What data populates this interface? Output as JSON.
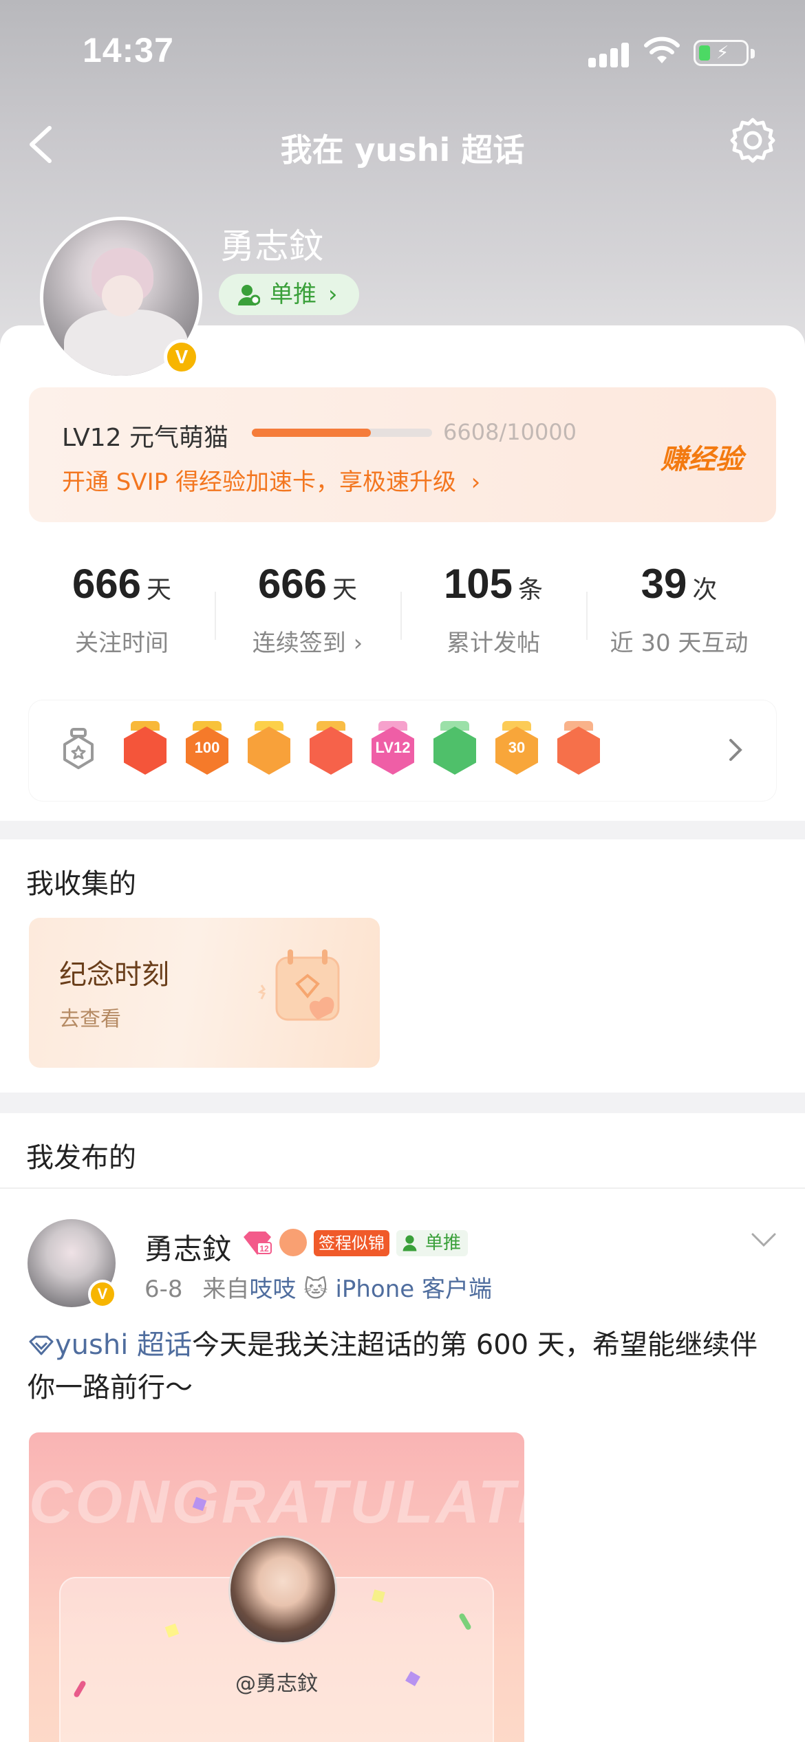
{
  "status_bar": {
    "time": "14:37"
  },
  "nav": {
    "title": "我在 yushi 超话"
  },
  "profile": {
    "name": "勇志鈫",
    "verified_mark": "V",
    "fan_tag": "单推"
  },
  "level": {
    "name": "LV12 元气萌猫",
    "progress_text": "6608/10000",
    "progress_fraction": 0.6608,
    "promo": "开通 SVIP 得经验加速卡，享极速升级",
    "earn_button": "赚经验"
  },
  "stats": [
    {
      "value": "666",
      "unit": "天",
      "label": "关注时间"
    },
    {
      "value": "666",
      "unit": "天",
      "label": "连续签到"
    },
    {
      "value": "105",
      "unit": "条",
      "label": "累计发帖"
    },
    {
      "value": "39",
      "unit": "次",
      "label": "近 30 天互动"
    }
  ],
  "badges": [
    {
      "icon": "cat-badge-icon",
      "color": "#f4553a",
      "top": "#f8b83a",
      "glyph": ""
    },
    {
      "icon": "100-days-badge-icon",
      "color": "#f57a2a",
      "top": "#f8c23a",
      "glyph": "100"
    },
    {
      "icon": "crown-badge-icon",
      "color": "#f8a13a",
      "top": "#fcd04a",
      "glyph": ""
    },
    {
      "icon": "cat-face-badge-icon",
      "color": "#f6624a",
      "top": "#f9bd46",
      "glyph": ""
    },
    {
      "icon": "lv12-badge-icon",
      "color": "#ef5ea6",
      "top": "#f6a1cc",
      "glyph": "LV12"
    },
    {
      "icon": "hand-badge-icon",
      "color": "#4fc06a",
      "top": "#9be0a8",
      "glyph": ""
    },
    {
      "icon": "30-days-badge-icon",
      "color": "#f8a63a",
      "top": "#fccb56",
      "glyph": "30"
    },
    {
      "icon": "rock-hand-badge-icon",
      "color": "#f6704a",
      "top": "#f9b28a",
      "glyph": ""
    }
  ],
  "collected": {
    "title": "我收集的",
    "card_title": "纪念时刻",
    "card_action": "去查看"
  },
  "published": {
    "title": "我发布的",
    "post": {
      "author": "勇志鈫",
      "verified_mark": "V",
      "level_badge": "12",
      "tag_label": "签程似锦",
      "fan_tag": "单推",
      "date": "6-8",
      "source_prefix": "来自",
      "source_app": "吱吱",
      "source_client": "iPhone 客户端",
      "topic": "yushi 超话",
      "text": "今天是我关注超话的第 600 天，希望能继续伴你一路前行～",
      "image": {
        "banner_text": "CONGRATULATE",
        "handle": "@勇志鈫"
      }
    }
  }
}
